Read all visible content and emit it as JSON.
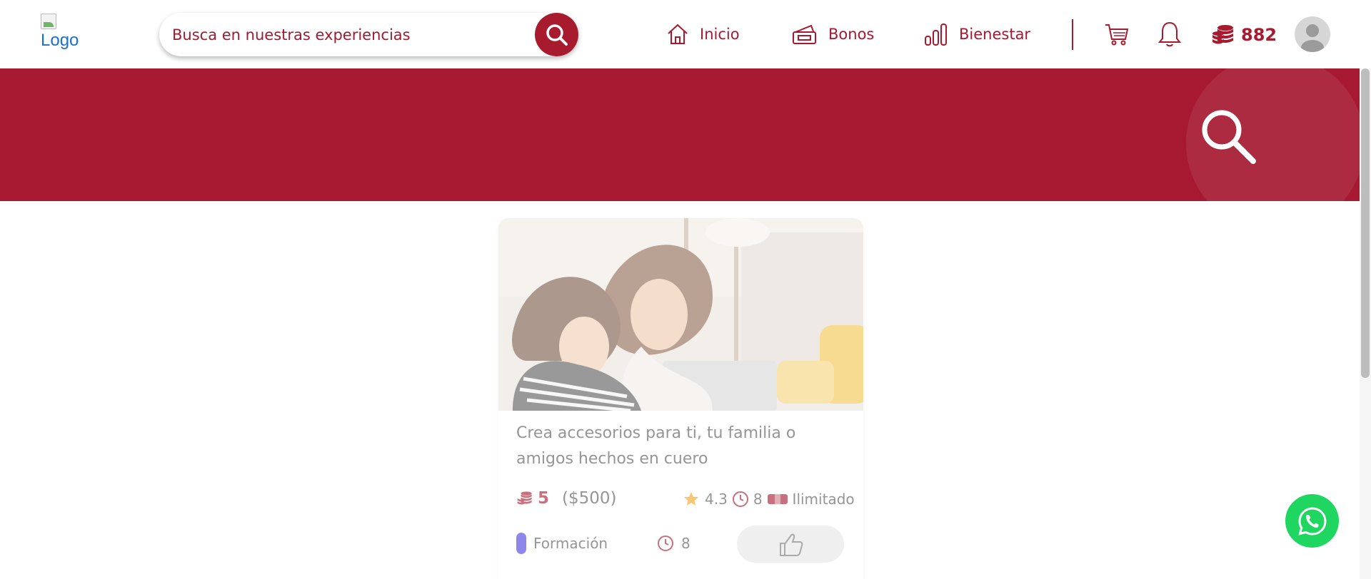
{
  "header": {
    "logo_alt": "Logo",
    "search": {
      "placeholder": "Busca en nuestras experiencias"
    },
    "nav": [
      {
        "label": "Inicio",
        "icon": "home-icon"
      },
      {
        "label": "Bonos",
        "icon": "voucher-icon"
      },
      {
        "label": "Bienestar",
        "icon": "bar-chart-icon"
      }
    ],
    "cart_icon": "cart-icon",
    "bell_icon": "bell-icon",
    "coins": "882",
    "avatar_icon": "user-avatar-icon"
  },
  "banner": {
    "icon": "search-icon"
  },
  "card": {
    "title": "Crea accesorios para ti, tu familia o amigos hechos en cuero",
    "points": "5",
    "price": "($500)",
    "rating": "4.3",
    "duration_meta": "8",
    "availability": "Ilimitado",
    "category": "Formación",
    "duration": "8"
  },
  "colors": {
    "brand": "#a81a2e",
    "banner": "#a61930",
    "category_tag": "#4a3fe0",
    "whatsapp": "#1fd661",
    "star": "#f5a623"
  },
  "whatsapp_icon": "whatsapp-icon"
}
